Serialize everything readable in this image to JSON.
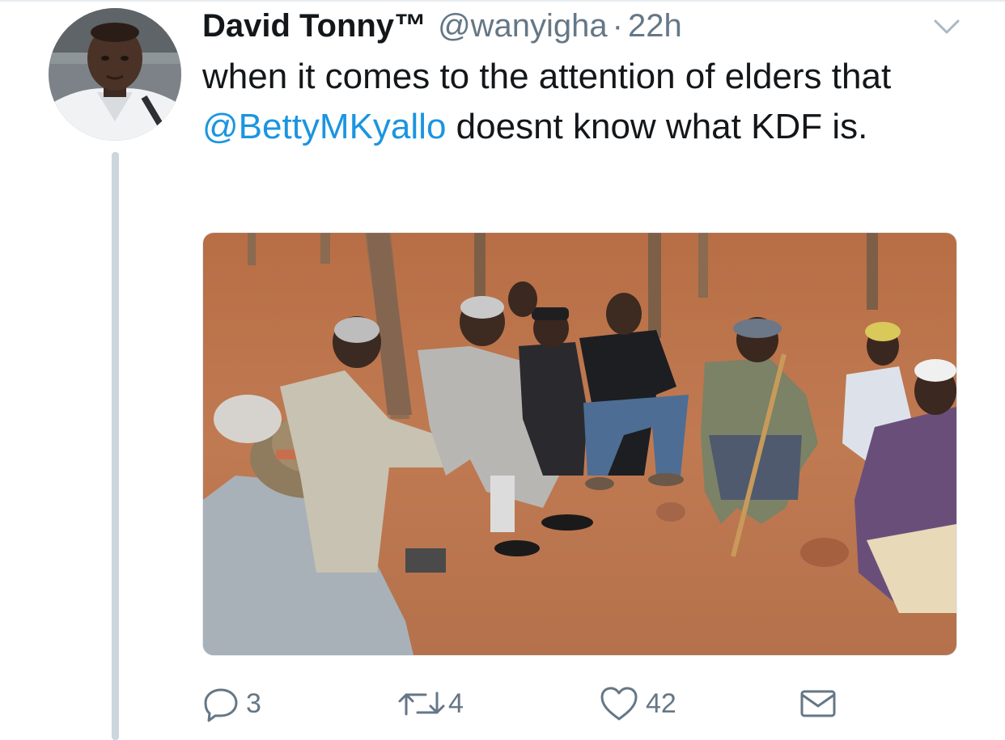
{
  "tweet": {
    "display_name": "David Tonny™",
    "handle": "@wanyigha",
    "separator": "·",
    "time": "22h",
    "text_before": "when it comes to the attention of elders that ",
    "mention": "@BettyMKyallo",
    "text_after": " doesnt know what KDF is."
  },
  "actions": {
    "reply_count": "3",
    "retweet_count": "4",
    "like_count": "42"
  },
  "icons": {
    "caret": "chevron-down-icon",
    "reply": "reply-icon",
    "retweet": "retweet-icon",
    "like": "heart-icon",
    "message": "envelope-icon"
  },
  "colors": {
    "text": "#14171a",
    "muted": "#657786",
    "link": "#1b95e0",
    "thread_line": "#ccd6dd"
  }
}
